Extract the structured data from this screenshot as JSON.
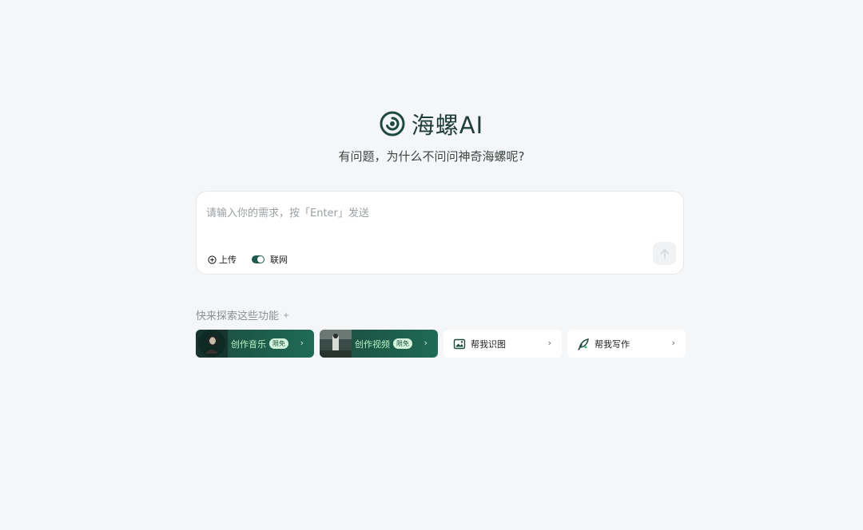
{
  "brand": {
    "name": "海螺AI",
    "tagline": "有问题，为什么不问问神奇海螺呢?",
    "color": "#1e3d35"
  },
  "composer": {
    "placeholder": "请输入你的需求，按「Enter」发送",
    "upload_label": "上传",
    "web_label": "联网",
    "web_enabled": true
  },
  "explore": {
    "title": "快来探索这些功能",
    "cards": [
      {
        "label": "创作音乐",
        "badge": "限免",
        "icon": "music-thumbnail",
        "style": "dark"
      },
      {
        "label": "创作视频",
        "badge": "限免",
        "icon": "video-thumbnail",
        "style": "dark"
      },
      {
        "label": "帮我识图",
        "icon": "image-icon",
        "style": "light"
      },
      {
        "label": "帮我写作",
        "icon": "pen-icon",
        "style": "light"
      }
    ]
  },
  "colors": {
    "accent": "#1e5a4c",
    "background": "#f5f6f8",
    "badge_bg": "#d4f3dd"
  }
}
